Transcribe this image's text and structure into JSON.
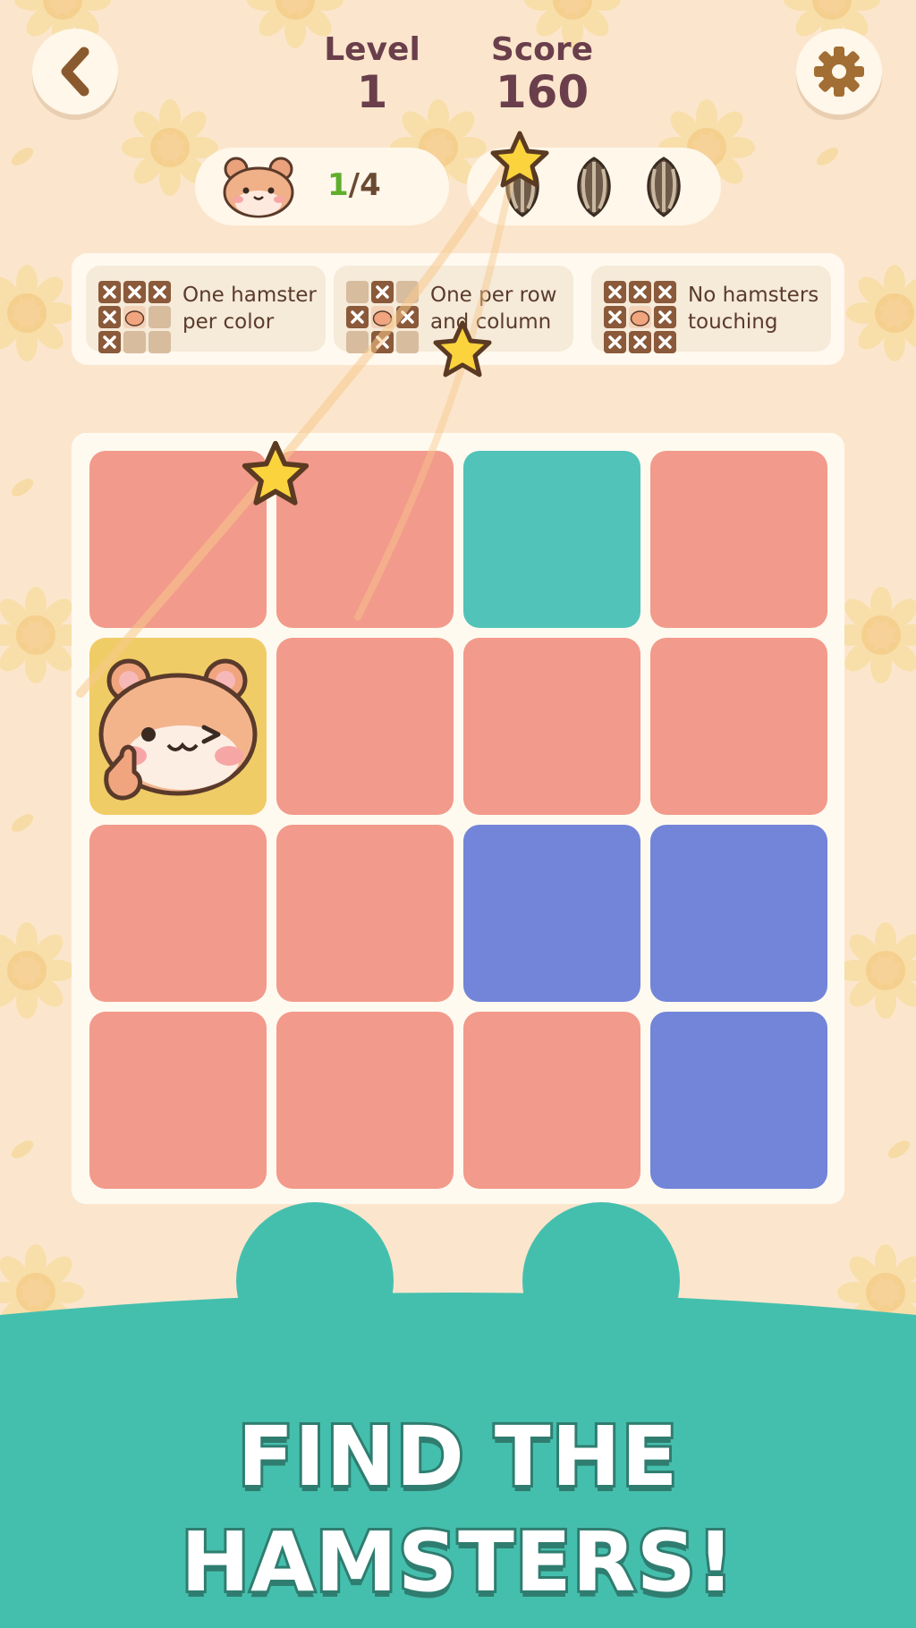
{
  "hud": {
    "level_label": "Level",
    "level_value": "1",
    "score_label": "Score",
    "score_value": "160"
  },
  "hamster_progress": {
    "found": "1",
    "separator": "/",
    "total": "4"
  },
  "seeds": {
    "count": 3,
    "icon": "sunflower-seed-icon"
  },
  "rules": [
    {
      "line1": "One hamster",
      "line2": "per color"
    },
    {
      "line1": "One per row",
      "line2": "and column"
    },
    {
      "line1": "No hamsters",
      "line2": "touching"
    }
  ],
  "board": {
    "size": 4,
    "colors": {
      "salmon": "#f29a8b",
      "teal": "#52c3b8",
      "blue": "#7285d8",
      "found": "#f0cc66"
    },
    "cells": [
      [
        "salmon",
        "salmon",
        "teal",
        "salmon"
      ],
      [
        "salmon",
        "salmon",
        "salmon",
        "salmon"
      ],
      [
        "salmon",
        "salmon",
        "blue",
        "blue"
      ],
      [
        "salmon",
        "salmon",
        "salmon",
        "blue"
      ]
    ],
    "hamster_at": {
      "row": 1,
      "col": 0
    }
  },
  "cta": {
    "line1": "FIND THE",
    "line2": "HAMSTERS!"
  },
  "theme": {
    "background": "#fbe6cd",
    "footer": "#45bfad",
    "text_dark": "#6a3f4b"
  }
}
